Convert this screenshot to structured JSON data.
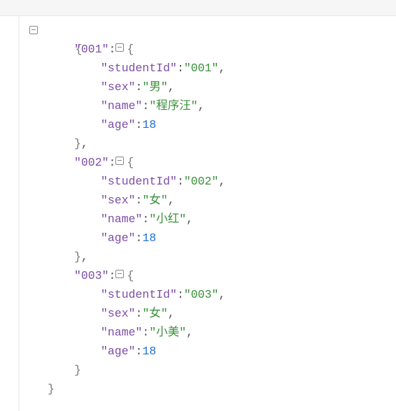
{
  "json_tree": {
    "001": {
      "studentId": "001",
      "sex": "男",
      "name": "程序汪",
      "age": 18
    },
    "002": {
      "studentId": "002",
      "sex": "女",
      "name": "小红",
      "age": 18
    },
    "003": {
      "studentId": "003",
      "sex": "女",
      "name": "小美",
      "age": 18
    }
  },
  "q": "″",
  "openBrace": "{",
  "closeBrace": "}",
  "colon": ":",
  "comma": ","
}
